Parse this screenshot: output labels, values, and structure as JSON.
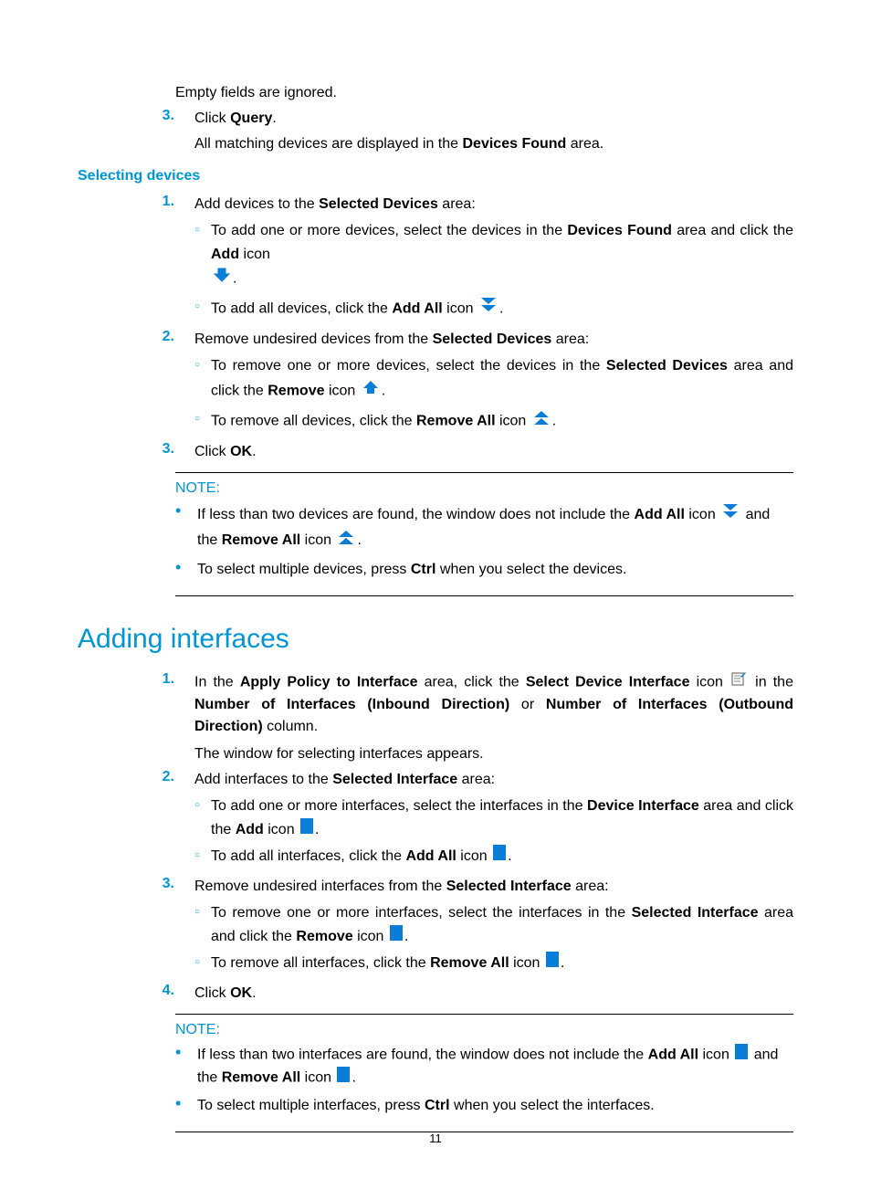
{
  "intro": {
    "empty_fields": "Empty fields are ignored.",
    "step3_click": "Click ",
    "query": "Query",
    "step3_after": ".",
    "all_matching": "All matching devices are displayed in the ",
    "devices_found": "Devices Found",
    "all_matching_after": " area."
  },
  "selecting_devices_heading": "Selecting devices",
  "sd": {
    "s1": {
      "pre": "Add devices to the ",
      "b1": "Selected Devices",
      "post": " area:",
      "a_pre": "To add one or more devices, select the devices in the ",
      "a_b1": "Devices Found",
      "a_mid": " area and click the ",
      "a_b2": "Add",
      "a_post": " icon ",
      "a_end": ".",
      "b_pre": "To add all devices, click the ",
      "b_b1": "Add All",
      "b_post": " icon ",
      "b_end": "."
    },
    "s2": {
      "pre": "Remove undesired devices from the ",
      "b1": "Selected Devices",
      "post": " area:",
      "a_pre": "To remove one or more devices, select the devices in the ",
      "a_b1": "Selected Devices",
      "a_mid": " area and click the ",
      "a_b2": "Remove",
      "a_post": " icon ",
      "a_end": ".",
      "b_pre": "To remove all devices, click the ",
      "b_b1": "Remove All",
      "b_post": " icon ",
      "b_end": "."
    },
    "s3": {
      "pre": "Click ",
      "b1": "OK",
      "post": "."
    }
  },
  "note1": {
    "label": "NOTE:",
    "a_pre": "If less than two devices are found, the window does not include the ",
    "a_b1": "Add All",
    "a_mid": " icon ",
    "a_mid2": " and the ",
    "a_b2": "Remove All",
    "a_post": " icon ",
    "a_end": ".",
    "b_pre": "To select multiple devices, press ",
    "b_b1": "Ctrl",
    "b_post": " when you select the devices."
  },
  "adding_interfaces_heading": "Adding interfaces",
  "ai": {
    "s1": {
      "pre": "In the ",
      "b1": "Apply Policy to Interface",
      "mid1": " area, click the ",
      "b2": "Select Device Interface",
      "mid2": " icon ",
      "mid3": " in the ",
      "b3": "Number of Interfaces (Inbound Direction)",
      "mid4": " or ",
      "b4": "Number of Interfaces (Outbound Direction)",
      "post": " column.",
      "line2": "The window for selecting interfaces appears."
    },
    "s2": {
      "pre": "Add interfaces to the ",
      "b1": "Selected Interface",
      "post": " area:",
      "a_pre": "To add one or more interfaces, select the interfaces in the ",
      "a_b1": "Device Interface",
      "a_mid": " area and click the ",
      "a_b2": "Add",
      "a_post": " icon ",
      "a_end": ".",
      "b_pre": "To add all interfaces, click the ",
      "b_b1": "Add All",
      "b_post": " icon ",
      "b_end": "."
    },
    "s3": {
      "pre": "Remove undesired interfaces from the ",
      "b1": "Selected Interface",
      "post": " area:",
      "a_pre": "To remove one or more interfaces, select the interfaces in the ",
      "a_b1": "Selected Interface",
      "a_mid": " area and click the ",
      "a_b2": "Remove",
      "a_post": " icon ",
      "a_end": ".",
      "b_pre": "To remove all interfaces, click the ",
      "b_b1": "Remove All",
      "b_post": " icon ",
      "b_end": "."
    },
    "s4": {
      "pre": "Click ",
      "b1": "OK",
      "post": "."
    }
  },
  "note2": {
    "label": "NOTE:",
    "a_pre": "If less than two interfaces are found, the window does not include the ",
    "a_b1": "Add All",
    "a_mid": " icon ",
    "a_mid2": " and the ",
    "a_b2": "Remove All",
    "a_post": " icon ",
    "a_end": ".",
    "b_pre": "To select multiple interfaces, press ",
    "b_b1": "Ctrl",
    "b_post": " when you select the interfaces."
  },
  "markers": {
    "n1": "1.",
    "n2": "2.",
    "n3": "3.",
    "n4": "4.",
    "circ": "○",
    "bull": "•"
  },
  "page_number": "11"
}
